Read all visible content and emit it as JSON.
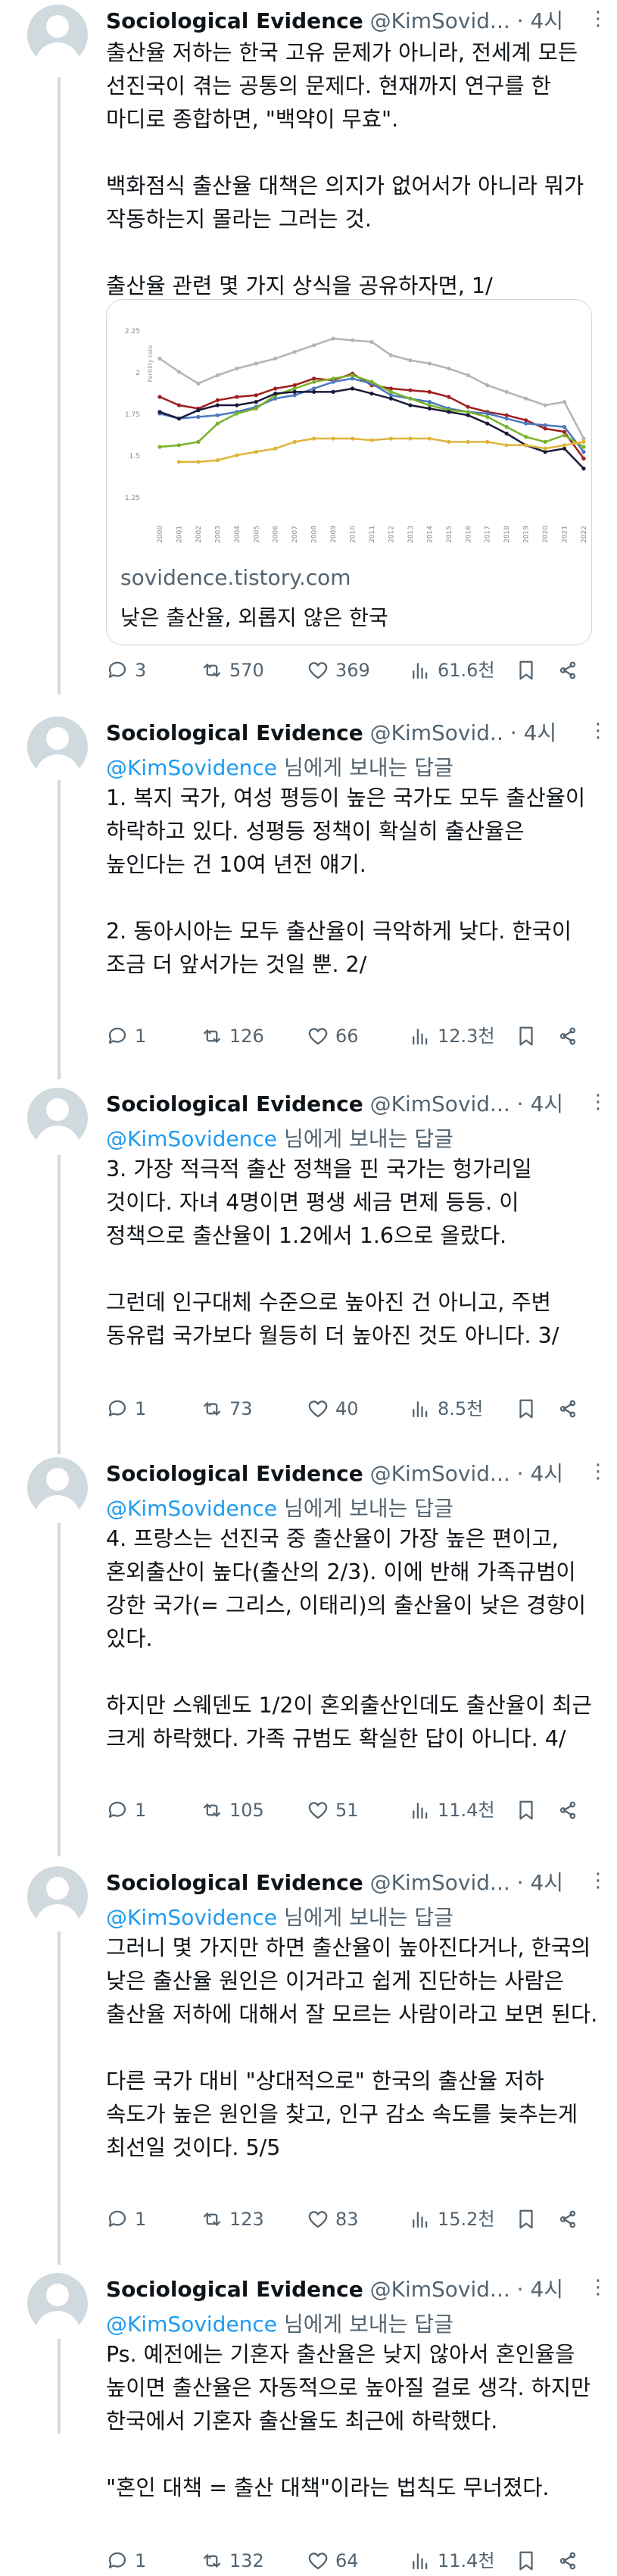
{
  "author": {
    "name": "Sociological Evidence",
    "handle_short": "@KimSovid...",
    "handle_shorter": "@KimSovid..",
    "time": "4시"
  },
  "reply": {
    "mention": "@KimSovidence",
    "suffix": " 님에게 보내는 답글"
  },
  "tweets": [
    {
      "text": "출산율 저하는 한국 고유 문제가 아니라, 전세계 모든\n선진국이 겪는 공통의 문제다. 현재까지 연구를 한\n마디로 종합하면, \"백약이 무효\".\n\n백화점식 출산율 대책은 의지가 없어서가 아니라 뭐가\n작동하는지 몰라는 그러는 것.\n\n출산율 관련 몇 가지 상식을 공유하자면, 1/",
      "card": {
        "domain": "sovidence.tistory.com",
        "title": "낮은 출산율, 외롭지 않은 한국"
      },
      "stats": {
        "replies": "3",
        "retweets": "570",
        "likes": "369",
        "views": "61.6천"
      }
    },
    {
      "text": "1. 복지 국가, 여성 평등이 높은 국가도 모두 출산율이\n하락하고 있다. 성평등 정책이 확실히 출산율은\n높인다는 건 10여 년전 얘기.\n\n2. 동아시아는 모두 출산율이 극악하게 낮다. 한국이\n조금 더 앞서가는 것일 뿐. 2/",
      "stats": {
        "replies": "1",
        "retweets": "126",
        "likes": "66",
        "views": "12.3천"
      }
    },
    {
      "text": "3. 가장 적극적 출산 정책을 핀 국가는 헝가리일\n것이다. 자녀 4명이면 평생 세금 면제 등등. 이\n정책으로 출산율이 1.2에서 1.6으로 올랐다.\n\n그런데 인구대체 수준으로 높아진 건 아니고, 주변\n동유럽 국가보다 월등히 더 높아진 것도 아니다. 3/",
      "stats": {
        "replies": "1",
        "retweets": "73",
        "likes": "40",
        "views": "8.5천"
      }
    },
    {
      "text": "4. 프랑스는 선진국 중 출산율이 가장 높은 편이고,\n혼외출산이 높다(출산의 2/3). 이에 반해 가족규범이\n강한 국가(= 그리스, 이태리)의 출산율이 낮은 경향이\n있다.\n\n하지만 스웨덴도 1/2이 혼외출산인데도 출산율이 최근\n크게 하락했다. 가족 규범도 확실한 답이 아니다. 4/",
      "stats": {
        "replies": "1",
        "retweets": "105",
        "likes": "51",
        "views": "11.4천"
      }
    },
    {
      "text": "그러니 몇 가지만 하면 출산율이 높아진다거나, 한국의\n낮은 출산율 원인은 이거라고 쉽게 진단하는 사람은\n출산율 저하에 대해서 잘 모르는 사람이라고 보면 된다.\n\n다른 국가 대비 \"상대적으로\" 한국의 출산율 저하\n속도가 높은 원인을 찾고, 인구 감소 속도를 늦추는게\n최선일 것이다. 5/5",
      "stats": {
        "replies": "1",
        "retweets": "123",
        "likes": "83",
        "views": "15.2천"
      }
    },
    {
      "text": "Ps. 예전에는 기혼자 출산율은 낮지 않아서 혼인율을\n높이면 출산율은 자동적으로 높아질 걸로 생각. 하지만\n한국에서 기혼자 출산율도 최근에 하락했다.\n\n\"혼인 대책 = 출산 대책\"이라는 법칙도 무너졌다.",
      "stats": {
        "replies": "1",
        "retweets": "132",
        "likes": "64",
        "views": "11.4천"
      }
    }
  ],
  "chart_data": {
    "type": "line",
    "ylabel": "Fertility rate",
    "ylim": [
      1.25,
      2.25
    ],
    "yticks": [
      "2.25",
      "2",
      "1.75",
      "1.5",
      "1.25"
    ],
    "x": [
      "2000",
      "2001",
      "2002",
      "2003",
      "2004",
      "2005",
      "2006",
      "2007",
      "2008",
      "2009",
      "2010",
      "2011",
      "2012",
      "2013",
      "2014",
      "2015",
      "2016",
      "2017",
      "2018",
      "2019",
      "2020",
      "2021",
      "2022"
    ],
    "series": [
      {
        "color": "#b4b4b4",
        "values": [
          2.08,
          2.0,
          1.93,
          1.98,
          2.02,
          2.05,
          2.08,
          2.12,
          2.16,
          2.2,
          2.19,
          2.18,
          2.1,
          2.07,
          2.05,
          2.02,
          1.98,
          1.92,
          1.88,
          1.84,
          1.8,
          1.82,
          1.6
        ]
      },
      {
        "color": "#a01e1e",
        "values": [
          1.85,
          1.8,
          1.78,
          1.83,
          1.85,
          1.86,
          1.9,
          1.92,
          1.96,
          1.95,
          1.99,
          1.92,
          1.9,
          1.89,
          1.88,
          1.85,
          1.79,
          1.76,
          1.74,
          1.71,
          1.66,
          1.64,
          1.48
        ]
      },
      {
        "color": "#4a78c0",
        "values": [
          1.75,
          1.72,
          1.73,
          1.74,
          1.76,
          1.79,
          1.84,
          1.86,
          1.9,
          1.94,
          1.96,
          1.93,
          1.86,
          1.84,
          1.82,
          1.78,
          1.76,
          1.75,
          1.72,
          1.69,
          1.68,
          1.67,
          1.52
        ]
      },
      {
        "color": "#7ab32a",
        "values": [
          1.55,
          1.56,
          1.58,
          1.69,
          1.75,
          1.78,
          1.86,
          1.9,
          1.94,
          1.96,
          1.98,
          1.94,
          1.88,
          1.84,
          1.8,
          1.77,
          1.76,
          1.73,
          1.67,
          1.61,
          1.58,
          1.62,
          1.55
        ]
      },
      {
        "color": "#1a1a3a",
        "values": [
          1.76,
          1.72,
          1.77,
          1.8,
          1.8,
          1.82,
          1.87,
          1.88,
          1.88,
          1.88,
          1.9,
          1.87,
          1.84,
          1.8,
          1.78,
          1.76,
          1.74,
          1.69,
          1.63,
          1.56,
          1.52,
          1.54,
          1.42
        ]
      },
      {
        "color": "#e0b43a",
        "values": [
          null,
          1.46,
          1.46,
          1.47,
          1.5,
          1.52,
          1.54,
          1.58,
          1.6,
          1.6,
          1.6,
          1.59,
          1.6,
          1.6,
          1.6,
          1.58,
          1.58,
          1.58,
          1.56,
          1.56,
          1.54,
          1.56,
          1.58
        ]
      }
    ]
  }
}
